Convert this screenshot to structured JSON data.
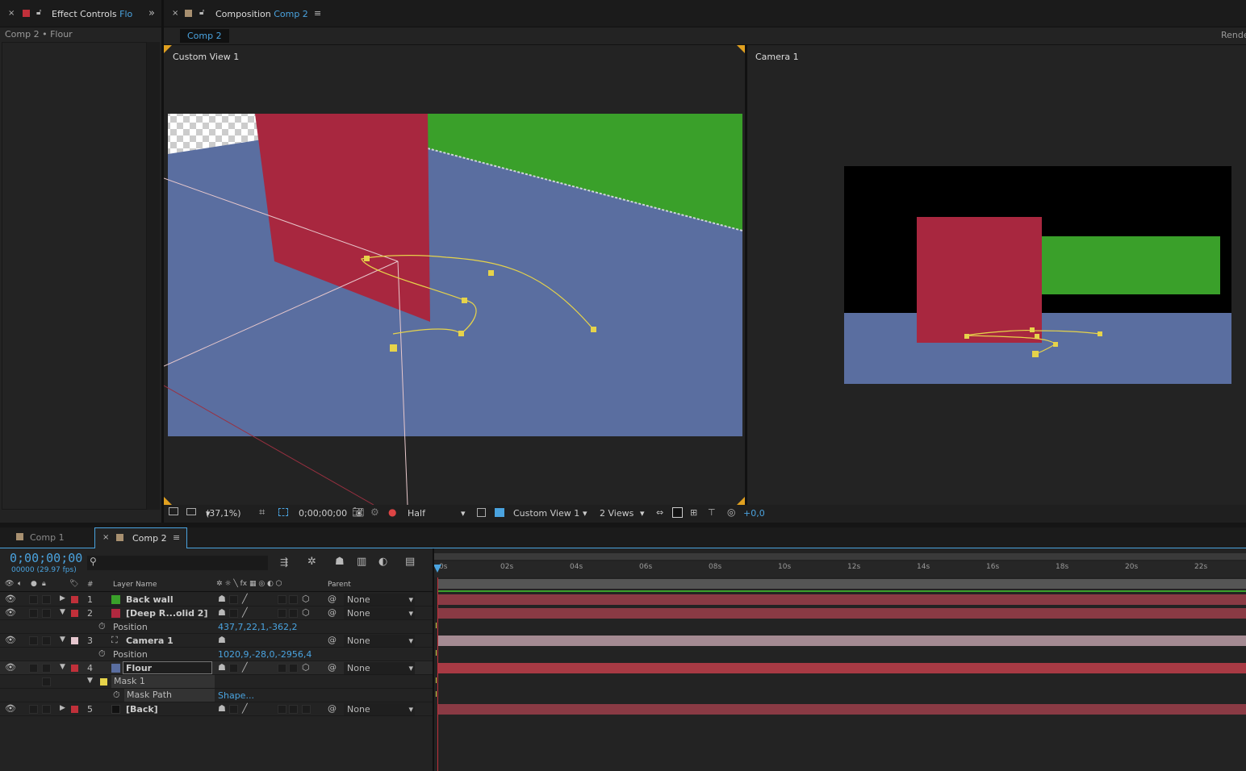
{
  "effect_controls": {
    "tab_label": "Effect Controls",
    "tab_suffix": "Flo",
    "breadcrumb": "Comp 2 • Flour"
  },
  "composition": {
    "tab_label": "Composition",
    "tab_comp": "Comp 2",
    "subtab": "Comp 2",
    "right_clip": "Rende"
  },
  "viewer": {
    "left_label": "Custom View 1",
    "right_label": "Camera 1"
  },
  "viewer_toolbar": {
    "zoom": "(37,1%)",
    "timecode": "0;00;00;00",
    "resolution": "Half",
    "view": "Custom View 1",
    "layout": "2 Views",
    "exposure": "+0,0"
  },
  "timeline": {
    "tabs": [
      {
        "label": "Comp 1"
      },
      {
        "label": "Comp 2"
      }
    ],
    "timecode": "0;00;00;00",
    "fps": "00000 (29.97 fps)",
    "headers": {
      "num": "#",
      "layer_name": "Layer Name",
      "parent": "Parent"
    },
    "ruler": [
      "0s",
      "02s",
      "04s",
      "06s",
      "08s",
      "10s",
      "12s",
      "14s",
      "16s",
      "18s",
      "20s",
      "22s"
    ],
    "layers": [
      {
        "num": "1",
        "name": "Back wall",
        "color": "#3aa02a",
        "parent": "None"
      },
      {
        "num": "2",
        "name": "[Deep R...olid 2]",
        "color": "#b0283f",
        "parent": "None"
      },
      {
        "prop": "Position",
        "value": "437,7,22,1,-362,2"
      },
      {
        "num": "3",
        "name": "Camera 1",
        "color": "#e6c7cf",
        "parent": "None"
      },
      {
        "prop": "Position",
        "value": "1020,9,-28,0,-2956,4"
      },
      {
        "num": "4",
        "name": "Flour",
        "color": "#5a6ea0",
        "parent": "None"
      },
      {
        "mask": "Mask 1"
      },
      {
        "prop": "Mask Path",
        "value": "Shape..."
      },
      {
        "num": "5",
        "name": "[Back]",
        "color": "#111111",
        "parent": "None"
      }
    ]
  },
  "colors": {
    "accent": "#4aa3df",
    "label_red": "#c0303a",
    "floor": "#5a6ea0",
    "wall_green": "#3aa02a",
    "wall_red": "#a8273f"
  }
}
